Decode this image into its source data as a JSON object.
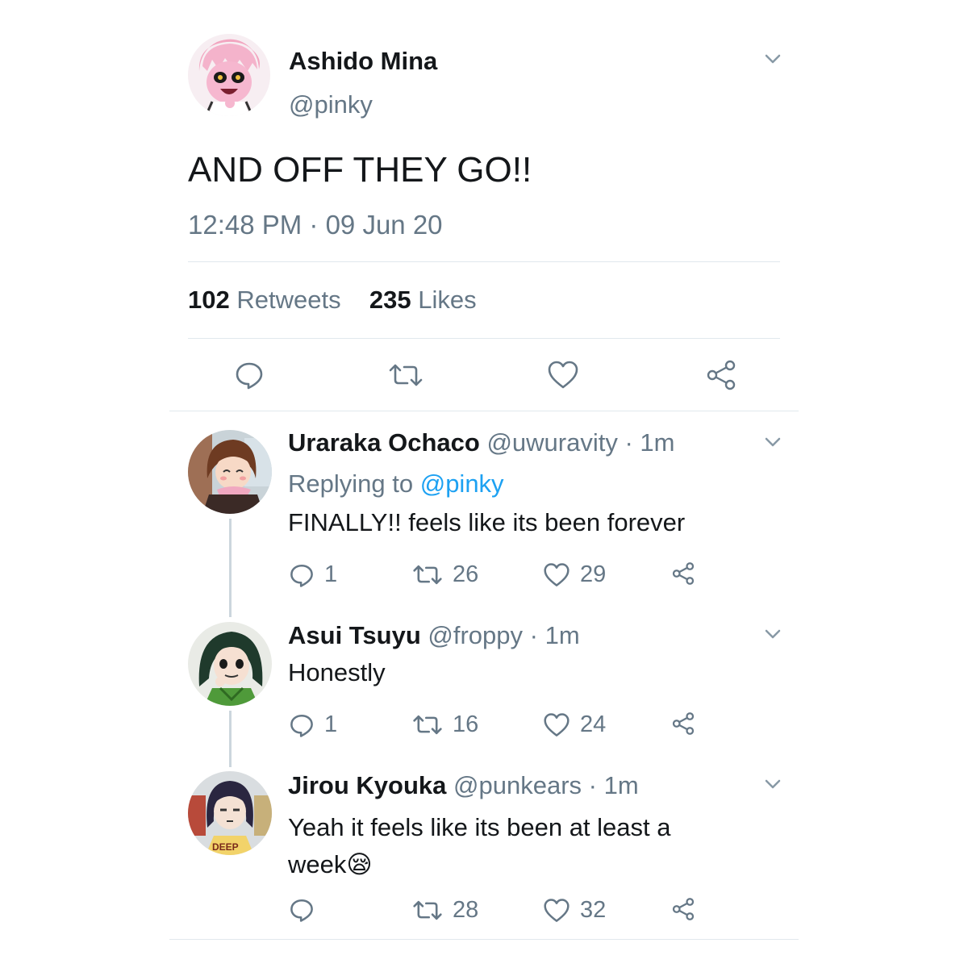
{
  "main_tweet": {
    "display_name": "Ashido Mina",
    "handle": "@pinky",
    "text": "AND OFF THEY GO!!",
    "timestamp": "12:48 PM · 09 Jun 20",
    "retweets_count": "102",
    "retweets_label": "Retweets",
    "likes_count": "235",
    "likes_label": "Likes",
    "actions": [
      "reply-icon",
      "retweet-icon",
      "like-icon",
      "share-icon"
    ]
  },
  "replies": [
    {
      "display_name": "Uraraka Ochaco",
      "handle": "@uwuravity",
      "time": "· 1m",
      "replying_prefix": "Replying to",
      "replying_to": "@pinky",
      "text": "FINALLY!! feels like its been forever",
      "reply_count": "1",
      "retweet_count": "26",
      "like_count": "29"
    },
    {
      "display_name": "Asui Tsuyu",
      "handle": "@froppy",
      "time": "· 1m",
      "text": "Honestly",
      "reply_count": "1",
      "retweet_count": "16",
      "like_count": "24"
    },
    {
      "display_name": "Jirou Kyouka",
      "handle": "@punkears",
      "time": "· 1m",
      "text_line1": "Yeah it feels like its been at least a",
      "text_line2": "week",
      "emoji": "😪",
      "retweet_count": "28",
      "like_count": "32"
    }
  ],
  "colors": {
    "text": "#14171a",
    "muted": "#657786",
    "link": "#1da1f2",
    "divider": "#e1e8ed"
  }
}
